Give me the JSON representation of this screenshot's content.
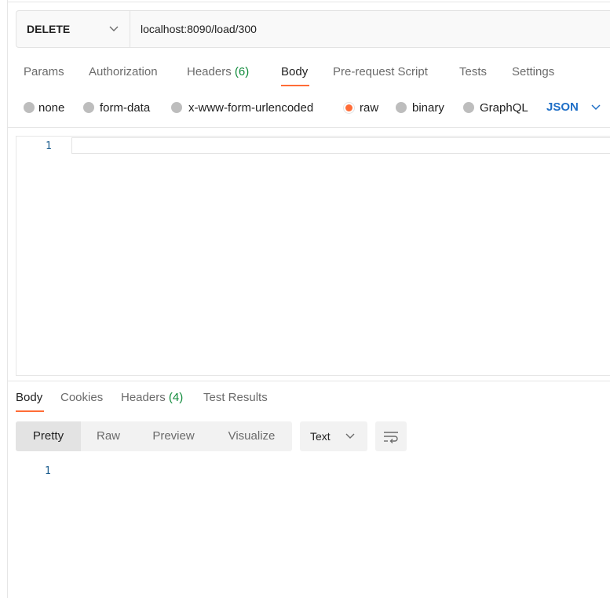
{
  "request": {
    "method": "DELETE",
    "url": "localhost:8090/load/300"
  },
  "request_tabs": [
    {
      "label": "Params"
    },
    {
      "label": "Authorization"
    },
    {
      "label": "Headers",
      "count": "(6)"
    },
    {
      "label": "Body",
      "active": true
    },
    {
      "label": "Pre-request Script"
    },
    {
      "label": "Tests"
    },
    {
      "label": "Settings"
    }
  ],
  "body_types": [
    {
      "label": "none"
    },
    {
      "label": "form-data"
    },
    {
      "label": "x-www-form-urlencoded"
    },
    {
      "label": "raw",
      "selected": true
    },
    {
      "label": "binary"
    },
    {
      "label": "GraphQL"
    }
  ],
  "raw_format": "JSON",
  "editor": {
    "line_numbers": [
      "1"
    ]
  },
  "response_tabs": [
    {
      "label": "Body",
      "active": true
    },
    {
      "label": "Cookies"
    },
    {
      "label": "Headers",
      "count": "(4)"
    },
    {
      "label": "Test Results"
    }
  ],
  "view_modes": [
    {
      "label": "Pretty",
      "active": true
    },
    {
      "label": "Raw"
    },
    {
      "label": "Preview"
    },
    {
      "label": "Visualize"
    }
  ],
  "response_format": "Text",
  "response": {
    "line_numbers": [
      "1"
    ]
  },
  "icons": {
    "method_dropdown": "chevron-down-icon",
    "format_dropdown": "chevron-down-icon",
    "wrap_toggle": "wrap-lines-icon"
  },
  "colors": {
    "accent": "#ff6c37",
    "json_link": "#1f6fc7",
    "count": "#0f8a3a",
    "line_number": "#1d5e8f"
  }
}
